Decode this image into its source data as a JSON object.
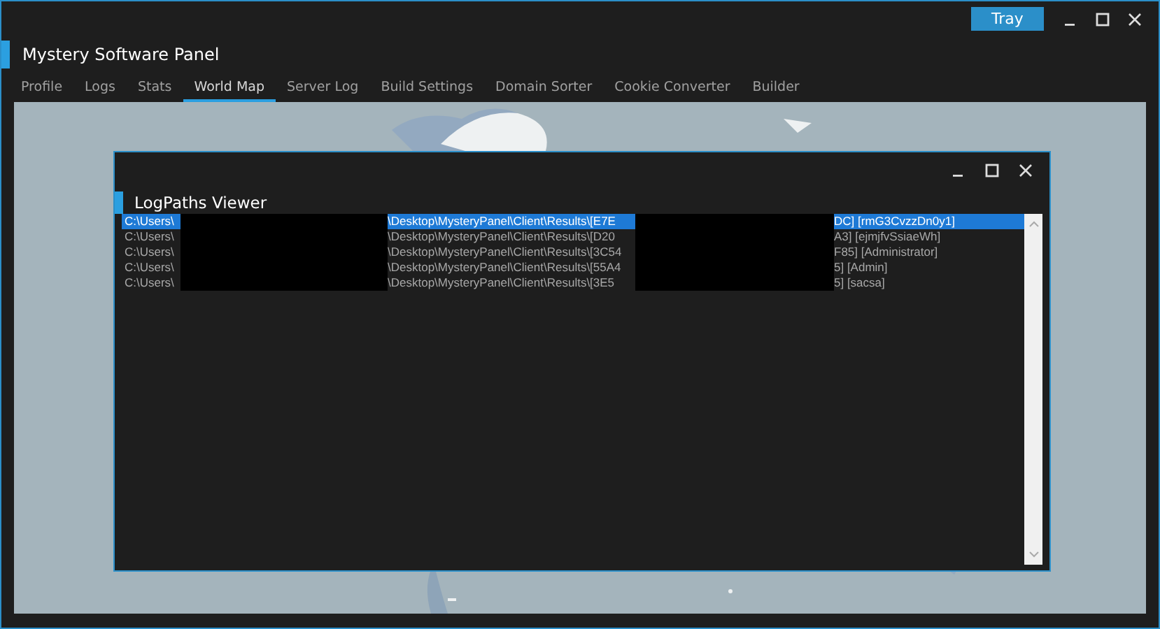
{
  "window": {
    "title": "Mystery Software Panel",
    "tray_button": "Tray"
  },
  "tabs": [
    {
      "label": "Profile",
      "selected": false
    },
    {
      "label": "Logs",
      "selected": false
    },
    {
      "label": "Stats",
      "selected": false
    },
    {
      "label": "World Map",
      "selected": true
    },
    {
      "label": "Server Log",
      "selected": false
    },
    {
      "label": "Build Settings",
      "selected": false
    },
    {
      "label": "Domain Sorter",
      "selected": false
    },
    {
      "label": "Cookie Converter",
      "selected": false
    },
    {
      "label": "Builder",
      "selected": false
    }
  ],
  "dialog": {
    "title": "LogPaths Viewer",
    "rows": [
      {
        "start": "C:\\Users\\",
        "middle": "\\Desktop\\MysteryPanel\\Client\\Results\\[E7E",
        "end": "DC] [rmG3CvzzDn0y1]",
        "selected": true
      },
      {
        "start": "C:\\Users\\",
        "middle": "\\Desktop\\MysteryPanel\\Client\\Results\\[D20",
        "end": "A3] [ejmjfvSsiaeWh]",
        "selected": false
      },
      {
        "start": "C:\\Users\\",
        "middle": "\\Desktop\\MysteryPanel\\Client\\Results\\[3C54",
        "end": "F85] [Administrator]",
        "selected": false
      },
      {
        "start": "C:\\Users\\",
        "middle": "\\Desktop\\MysteryPanel\\Client\\Results\\[55A4",
        "end": "5] [Admin]",
        "selected": false
      },
      {
        "start": "C:\\Users\\",
        "middle": "\\Desktop\\MysteryPanel\\Client\\Results\\[3E5",
        "end": "5] [sacsa]",
        "selected": false
      }
    ]
  }
}
